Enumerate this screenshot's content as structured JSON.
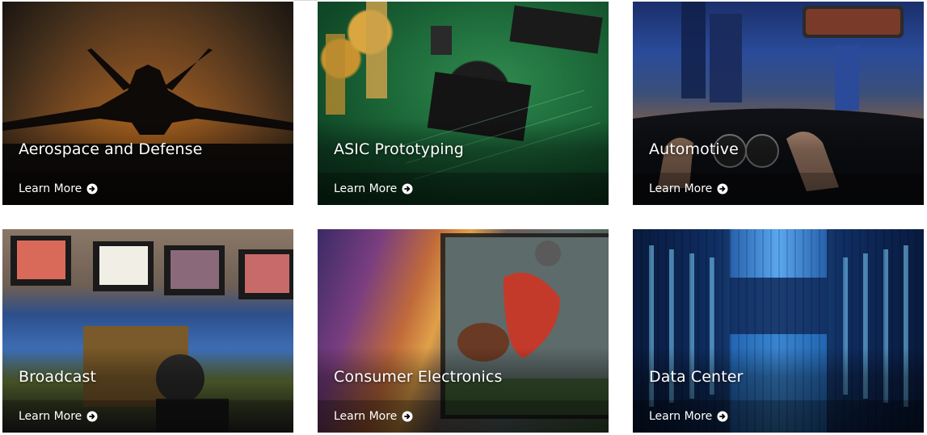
{
  "tiles": [
    {
      "id": "aerospace-and-defense",
      "title": "Aerospace and Defense",
      "cta": "Learn More",
      "icon": "arrow-circle-right-icon"
    },
    {
      "id": "asic-prototyping",
      "title": "ASIC Prototyping",
      "cta": "Learn More",
      "icon": "arrow-circle-right-icon"
    },
    {
      "id": "automotive",
      "title": "Automotive",
      "cta": "Learn More",
      "icon": "arrow-circle-right-icon"
    },
    {
      "id": "broadcast",
      "title": "Broadcast",
      "cta": "Learn More",
      "icon": "arrow-circle-right-icon"
    },
    {
      "id": "consumer-electronics",
      "title": "Consumer Electronics",
      "cta": "Learn More",
      "icon": "arrow-circle-right-icon"
    },
    {
      "id": "data-center",
      "title": "Data Center",
      "cta": "Learn More",
      "icon": "arrow-circle-right-icon"
    }
  ],
  "colors": {
    "text": "#ffffff",
    "page_background": "#ffffff"
  }
}
